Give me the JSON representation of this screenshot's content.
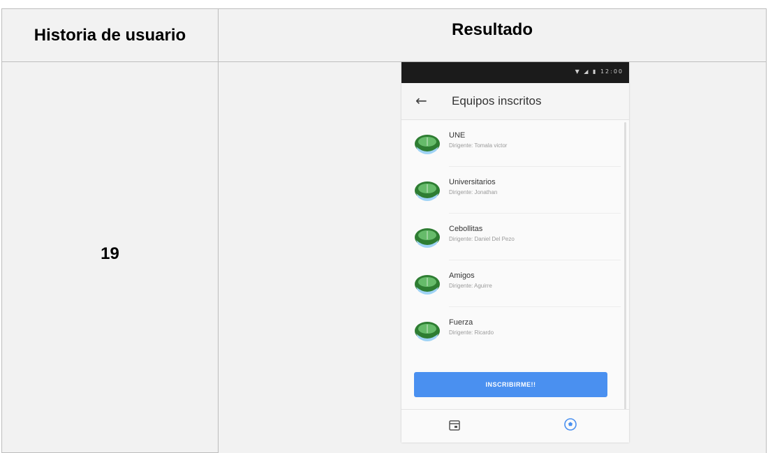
{
  "table": {
    "header_left": "Historia de usuario",
    "header_right": "Resultado",
    "row_number": "19"
  },
  "phone": {
    "status_icons": "▼ ◢ ▮ 12:00",
    "appbar": {
      "back_icon": "arrow-left-icon",
      "title": "Equipos inscritos"
    },
    "teams": [
      {
        "name": "UNE",
        "subtitle": "Dirigente: Tomala victor"
      },
      {
        "name": "Universitarios",
        "subtitle": "Dirigente: Jonathan"
      },
      {
        "name": "Cebollitas",
        "subtitle": "Dirigente: Daniel Del Pezo"
      },
      {
        "name": "Amigos",
        "subtitle": "Dirigente: Aguirre"
      },
      {
        "name": "Fuerza",
        "subtitle": "Dirigente: Ricardo"
      }
    ],
    "button_label": "INSCRIBIRME!!",
    "bottom_nav": [
      "calendar-icon",
      "soccer-ball-icon"
    ],
    "accent_color": "#4a90f0"
  }
}
